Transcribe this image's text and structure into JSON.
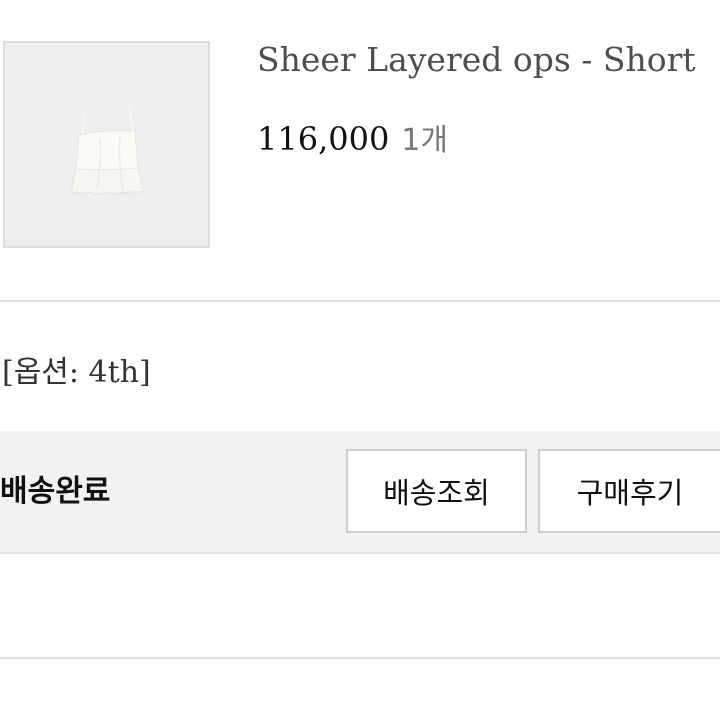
{
  "order_item": {
    "title": "Sheer Layered ops - Short",
    "price": "116,000",
    "quantity": "1개",
    "option": "[옵션: 4th]",
    "thumbnail_icon": "white-camisole-dress-image"
  },
  "order_status": {
    "status_text": "배송완료",
    "track_button_label": "배송조회",
    "review_button_label": "구매후기"
  }
}
